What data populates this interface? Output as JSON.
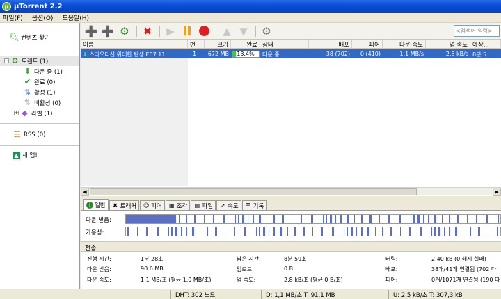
{
  "window": {
    "title": "µTorrent 2.2",
    "icon": "utorrent-logo-icon"
  },
  "menu": [
    "파일(F)",
    "옵션(O)",
    "도움말(H)"
  ],
  "toolbar": {
    "buttons": [
      "add-torrent-icon",
      "add-url-icon",
      "create-torrent-icon",
      "remove-icon",
      "start-icon",
      "pause-icon",
      "stop-icon",
      "move-up-icon",
      "move-down-icon",
      "preferences-icon"
    ],
    "search_placeholder": "<검색어 입력>"
  },
  "sidebar": {
    "find_content": "컨텐츠 찾기",
    "torrents": "토렌트 (1)",
    "downloading": "다운 중 (1)",
    "completed": "완료 (0)",
    "active": "활성 (1)",
    "inactive": "비활성 (0)",
    "labels": "라벨 (1)",
    "rss": "RSS (0)",
    "new_app": "새 앱!"
  },
  "list": {
    "columns": [
      "이름",
      "번",
      "크기",
      "완료",
      "상태",
      "배포",
      "피어",
      "다운 속도",
      "업 속도",
      "예상..."
    ],
    "row": {
      "name": "스타오디션 위대한 탄생 E07.11...",
      "num": "1",
      "size": "672 MB",
      "done": "13.4%",
      "done_value": 0.134,
      "status": "다운 중",
      "seeds": "38 (702)",
      "peers": "0 (410)",
      "down_speed": "1.1 MB/s",
      "up_speed": "2.8 kB/s",
      "eta": "8분 5..."
    }
  },
  "tabs": [
    "일반",
    "트래커",
    "피어",
    "조각",
    "파일",
    "속도",
    "기록"
  ],
  "general": {
    "downloaded_label": "다운 받음:",
    "availability_label": "가용성:",
    "section_title": "전송",
    "elapsed_label": "진행 시간:",
    "elapsed": "1분 28초",
    "downloaded2_label": "다운 받음:",
    "downloaded2": "90.6 MB",
    "down_speed_label": "다운 속도:",
    "down_speed": "1.1 MB/초 (평균 1.0 MB/초)",
    "remaining_label": "남은 시간:",
    "remaining": "8분 59초",
    "uploaded_label": "업로드:",
    "uploaded": "0 B",
    "up_speed_label": "업 속도:",
    "up_speed": "2.8 kB/초 (평균 0 B/초)",
    "wasted_label": "버림:",
    "wasted": "2.40 kB (0 해시 실패)",
    "seeds_label": "배포:",
    "seeds": "38개/41개 연결됨 (702 다",
    "peers_label": "피어:",
    "peers": "0개/1071개 연결됨 (190 다"
  },
  "statusbar": {
    "dht": "DHT: 302 노드",
    "down": "D: 1,1 MB/초 T: 91,1 MB",
    "up": "U: 2,5 kB/초 T: 307,3 kB"
  },
  "colors": {
    "selection": "#3169c6",
    "progress": "#44c44a",
    "pieces": "#5c6fc2"
  }
}
